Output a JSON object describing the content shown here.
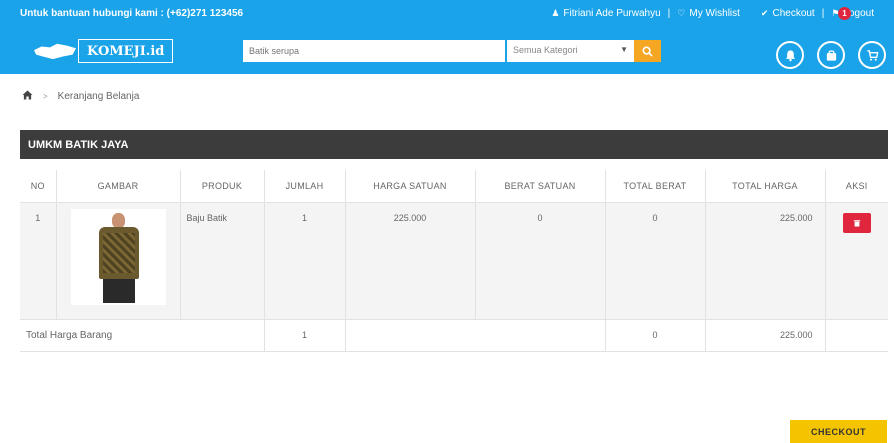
{
  "topbar": {
    "help_text": "Untuk bantuan hubungi kami : (+62)271 123456",
    "user_name": "Fitriani Ade Purwahyu",
    "wishlist_label": "My Wishlist",
    "checkout_label": "Checkout",
    "logout_label": "Logout",
    "separator": "|"
  },
  "header": {
    "logo_text": "KOMEJI.id",
    "search_placeholder": "Batik serupa",
    "category_selected": "Semua Kategori",
    "cart_badge": "1"
  },
  "breadcrumb": {
    "separator": ">",
    "current": "Keranjang Belanja"
  },
  "store": {
    "name": "UMKM BATIK JAYA"
  },
  "table": {
    "headers": [
      "NO",
      "GAMBAR",
      "PRODUK",
      "JUMLAH",
      "HARGA SATUAN",
      "BERAT SATUAN",
      "TOTAL BERAT",
      "TOTAL HARGA",
      "AKSI"
    ],
    "rows": [
      {
        "no": "1",
        "product": "Baju Batik",
        "qty": "1",
        "unit_price": "225.000",
        "unit_weight": "0",
        "total_weight": "0",
        "total_price": "225.000"
      }
    ],
    "total": {
      "label": "Total Harga Barang",
      "qty": "1",
      "total_weight": "0",
      "total_price": "225.000"
    }
  },
  "checkout_button": "CHECKOUT",
  "colors": {
    "primary": "#1aa3e8",
    "accent_orange": "#f5a623",
    "checkout_yellow": "#f5c400",
    "delete_red": "#e0263c",
    "store_bar": "#3c3c3c"
  }
}
